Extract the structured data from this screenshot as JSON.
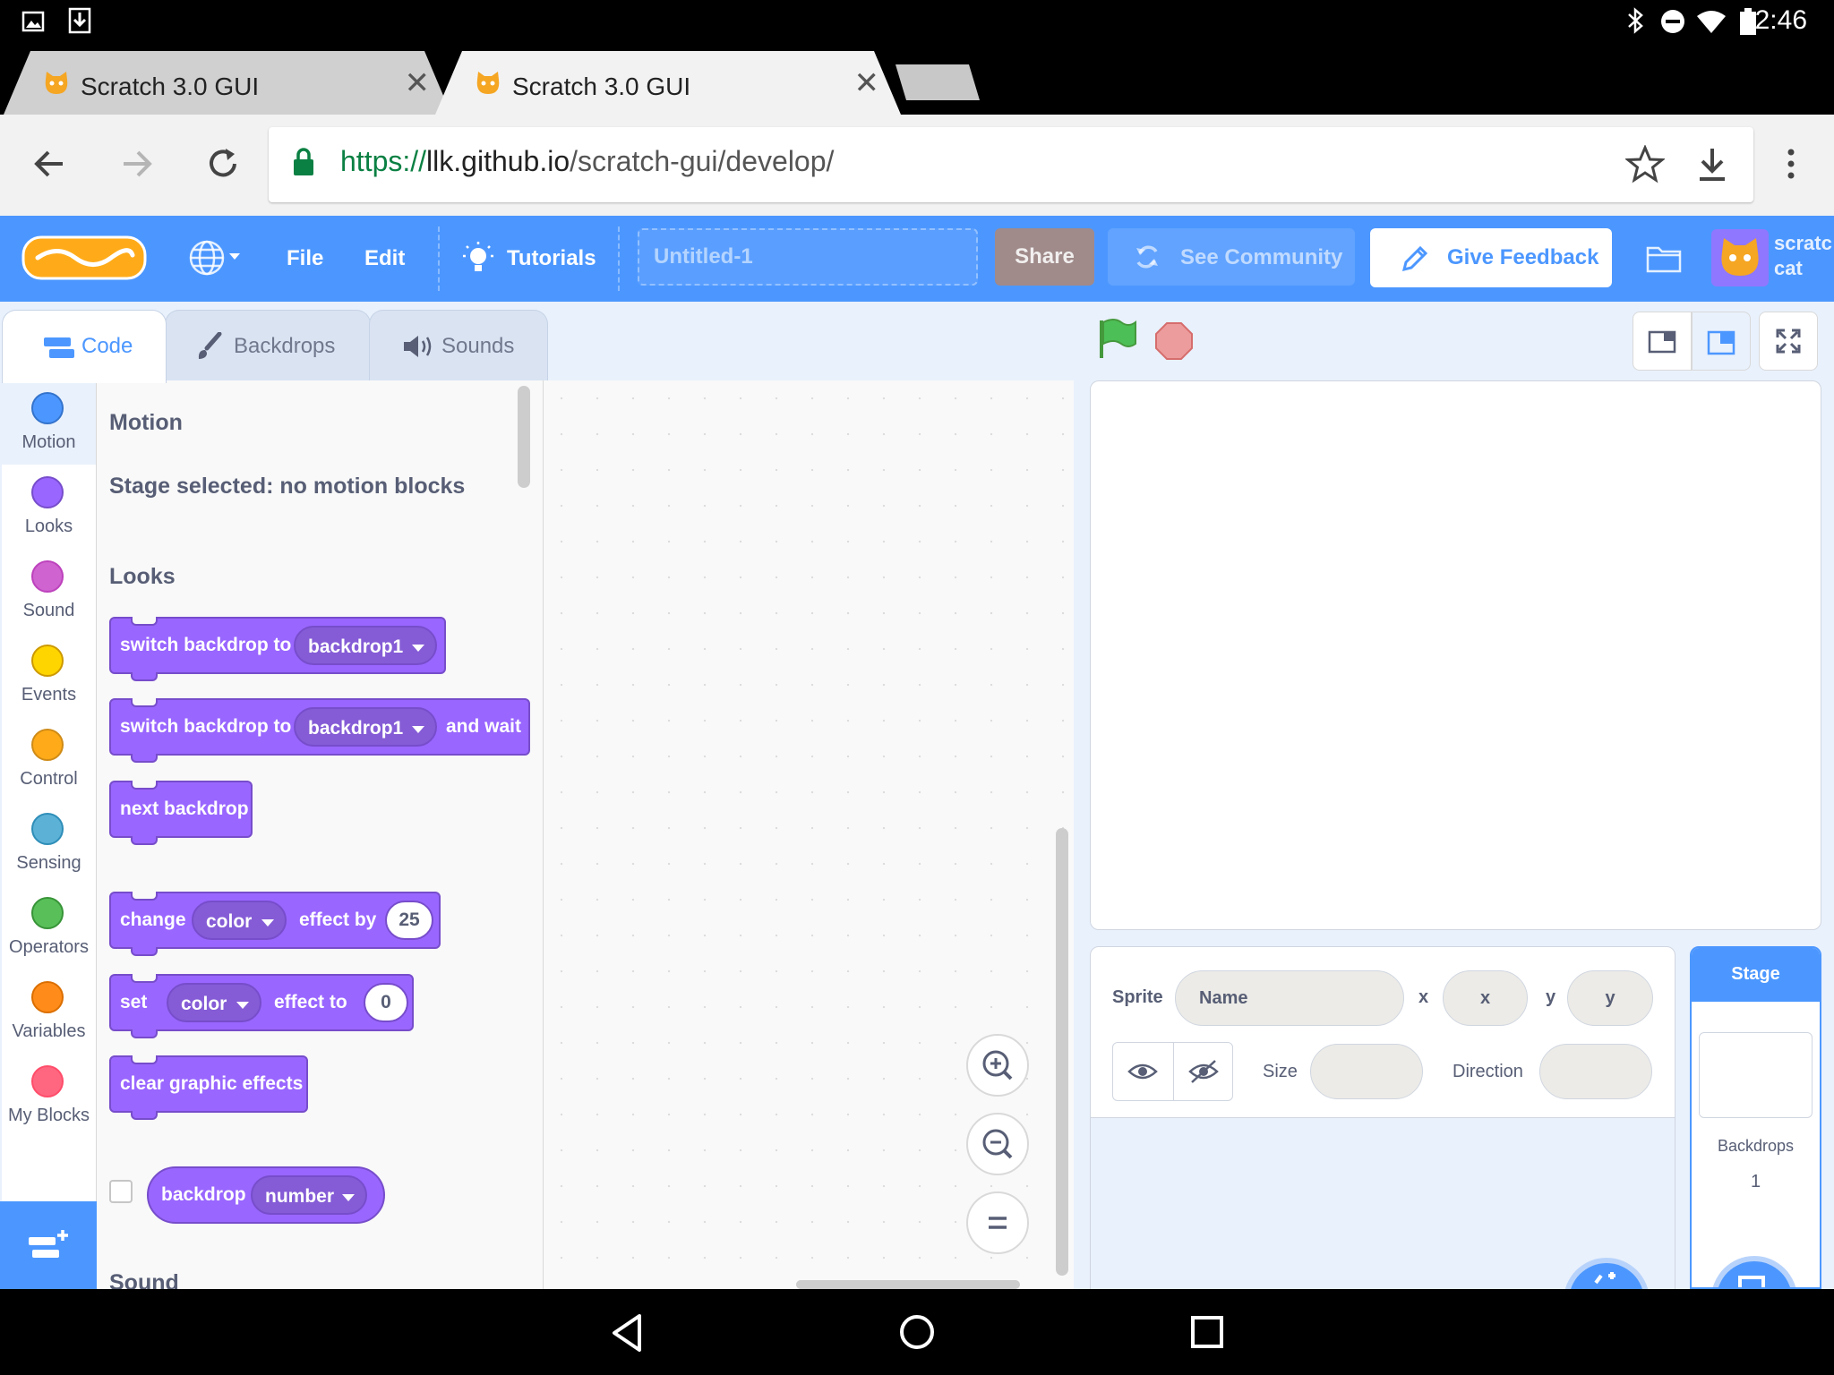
{
  "status_bar": {
    "time": "2:46"
  },
  "browser": {
    "tabs": [
      {
        "title": "Scratch 3.0 GUI"
      },
      {
        "title": "Scratch 3.0 GUI"
      }
    ],
    "url": {
      "scheme": "https://",
      "host": "llk.github.io",
      "path": "/scratch-gui/develop/"
    }
  },
  "menu": {
    "file": "File",
    "edit": "Edit",
    "tutorials": "Tutorials",
    "project_title_placeholder": "Untitled-1",
    "share": "Share",
    "see_community": "See Community",
    "give_feedback": "Give Feedback",
    "user_name_line1": "scratc",
    "user_name_line2": "cat"
  },
  "editor_tabs": {
    "code": "Code",
    "backdrops": "Backdrops",
    "sounds": "Sounds"
  },
  "categories": [
    {
      "label": "Motion",
      "color": "#4c97ff"
    },
    {
      "label": "Looks",
      "color": "#9966ff"
    },
    {
      "label": "Sound",
      "color": "#cf63cf"
    },
    {
      "label": "Events",
      "color": "#ffd500"
    },
    {
      "label": "Control",
      "color": "#ffab19"
    },
    {
      "label": "Sensing",
      "color": "#5cb1d6"
    },
    {
      "label": "Operators",
      "color": "#59c059"
    },
    {
      "label": "Variables",
      "color": "#ff8c1a"
    },
    {
      "label": "My Blocks",
      "color": "#ff6680"
    }
  ],
  "flyout": {
    "motion_heading": "Motion",
    "motion_note": "Stage selected: no motion blocks",
    "looks_heading": "Looks",
    "sound_heading": "Sound",
    "blocks": {
      "switch_backdrop": {
        "text": "switch backdrop to",
        "menu": "backdrop1"
      },
      "switch_backdrop_wait": {
        "text": "switch backdrop to",
        "menu": "backdrop1",
        "suffix": "and wait"
      },
      "next_backdrop": {
        "text": "next backdrop"
      },
      "change_effect": {
        "text": "change",
        "menu": "color",
        "mid": "effect by",
        "value": "25"
      },
      "set_effect": {
        "text": "set",
        "menu": "color",
        "mid": "effect to",
        "value": "0"
      },
      "clear_effects": {
        "text": "clear graphic effects"
      },
      "backdrop_reporter": {
        "text": "backdrop",
        "menu": "number"
      }
    }
  },
  "sprite_info": {
    "sprite_label": "Sprite",
    "name_placeholder": "Name",
    "x_label": "x",
    "x_placeholder": "x",
    "y_label": "y",
    "y_placeholder": "y",
    "size_label": "Size",
    "direction_label": "Direction"
  },
  "stage_panel": {
    "title": "Stage",
    "backdrops_label": "Backdrops",
    "backdrops_count": "1"
  },
  "colors": {
    "scratch_blue": "#4c97ff",
    "looks_purple": "#9966ff",
    "looks_border": "#774dcb"
  }
}
